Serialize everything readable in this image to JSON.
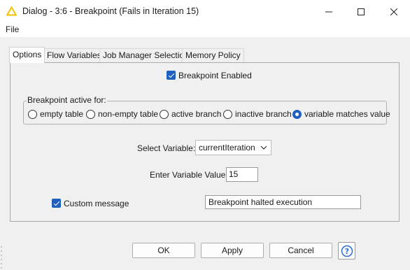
{
  "window": {
    "title": "Dialog - 3:6 - Breakpoint (Fails in Iteration 15)",
    "icon": "knime-warning-triangle-icon",
    "accent_color": "#f2c200"
  },
  "menu": {
    "file_label": "File"
  },
  "tabs": [
    {
      "label": "Options",
      "active": true
    },
    {
      "label": "Flow Variables",
      "active": false
    },
    {
      "label": "Job Manager Selection",
      "active": false
    },
    {
      "label": "Memory Policy",
      "active": false
    }
  ],
  "options": {
    "breakpoint_enabled": {
      "label": "Breakpoint Enabled",
      "checked": true
    },
    "active_for": {
      "legend": "Breakpoint active for:",
      "options": [
        {
          "label": "empty table",
          "selected": false
        },
        {
          "label": "non-empty table",
          "selected": false
        },
        {
          "label": "active branch",
          "selected": false
        },
        {
          "label": "inactive branch",
          "selected": false
        },
        {
          "label": "variable matches value",
          "selected": true
        }
      ]
    },
    "select_variable": {
      "label": "Select Variable:",
      "value": "currentIteration"
    },
    "variable_value": {
      "label": "Enter Variable Value:",
      "value": "15"
    },
    "custom_message": {
      "label": "Custom message",
      "checked": true,
      "value": "Breakpoint halted execution"
    }
  },
  "buttons": {
    "ok": "OK",
    "apply": "Apply",
    "cancel": "Cancel",
    "help_icon": "question-circle-icon"
  },
  "colors": {
    "checkbox_blue": "#1f5fbf",
    "help_blue": "#2a6ed4"
  }
}
